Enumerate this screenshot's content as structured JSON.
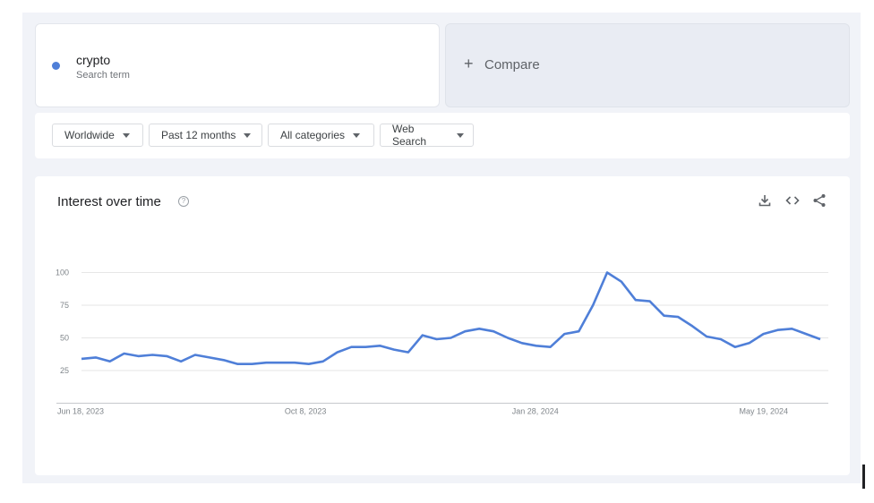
{
  "search_term": {
    "name": "crypto",
    "type": "Search term",
    "color": "#4f7fd8"
  },
  "compare": {
    "plus": "+",
    "label": "Compare"
  },
  "filters": [
    {
      "label": "Worldwide"
    },
    {
      "label": "Past 12 months"
    },
    {
      "label": "All categories"
    },
    {
      "label": "Web Search"
    }
  ],
  "chart": {
    "title": "Interest over time",
    "help": "?",
    "tools": [
      "download-icon",
      "embed-icon",
      "share-icon"
    ]
  },
  "chart_data": {
    "type": "line",
    "title": "Interest over time",
    "xlabel": "",
    "ylabel": "",
    "ylim": [
      0,
      100
    ],
    "yticks": [
      25,
      50,
      75,
      100
    ],
    "grid": true,
    "legend": "none",
    "x_tick_labels": [
      "Jun 18, 2023",
      "Oct 8, 2023",
      "Jan 28, 2024",
      "May 19, 2024"
    ],
    "x_tick_indices": [
      0,
      16,
      32,
      48
    ],
    "series": [
      {
        "color": "#4f7fd8",
        "values": [
          34,
          35,
          32,
          38,
          36,
          37,
          36,
          32,
          37,
          35,
          33,
          30,
          30,
          31,
          31,
          31,
          30,
          32,
          39,
          43,
          43,
          44,
          41,
          39,
          52,
          49,
          50,
          55,
          57,
          55,
          50,
          46,
          44,
          43,
          53,
          55,
          75,
          100,
          93,
          79,
          78,
          67,
          66,
          59,
          51,
          49,
          43,
          46,
          53,
          56,
          57,
          53,
          49
        ]
      }
    ]
  }
}
